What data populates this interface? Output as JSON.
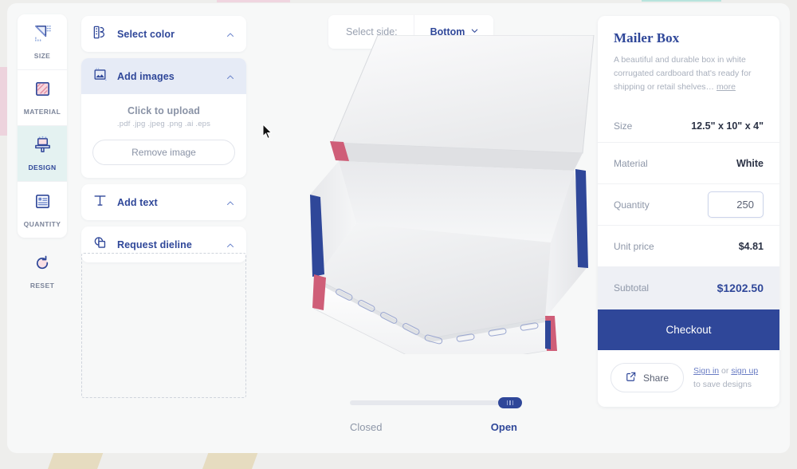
{
  "rail": {
    "items": [
      {
        "label": "SIZE",
        "icon": "ruler-triangle-icon",
        "active": false
      },
      {
        "label": "MATERIAL",
        "icon": "material-swatch-icon",
        "active": false
      },
      {
        "label": "DESIGN",
        "icon": "design-brush-icon",
        "active": true
      },
      {
        "label": "QUANTITY",
        "icon": "list-quantity-icon",
        "active": false
      }
    ],
    "reset": {
      "label": "RESET",
      "icon": "reset-circular-arrow-icon"
    }
  },
  "panel": {
    "select_color": {
      "label": "Select color",
      "icon": "color-palette-icon",
      "expanded": true
    },
    "add_images": {
      "label": "Add images",
      "icon": "image-frame-icon",
      "expanded": true,
      "upload_title": "Click to upload",
      "upload_formats": ".pdf .jpg .jpeg .png .ai .eps",
      "remove_label": "Remove image"
    },
    "add_text": {
      "label": "Add text",
      "icon": "text-t-icon",
      "expanded": true
    },
    "request_dieline": {
      "label": "Request dieline",
      "icon": "dieline-layers-icon",
      "expanded": true
    }
  },
  "stage": {
    "side_selector": {
      "label": "Select side:",
      "value": "Bottom",
      "icon": "chevron-down-icon"
    },
    "slider": {
      "left_label": "Closed",
      "right_label": "Open",
      "value": 100
    },
    "preview_alt": "white corrugated mailer box, open, bottom side"
  },
  "summary": {
    "title": "Mailer Box",
    "description": "A beautiful and durable box in white corrugated cardboard that's ready for shipping or retail shelves…",
    "more_link": "more",
    "rows": [
      {
        "key": "Size",
        "value": "12.5\" x 10\" x 4\""
      },
      {
        "key": "Material",
        "value": "White"
      }
    ],
    "quantity": {
      "key": "Quantity",
      "value": "250"
    },
    "unit_price": {
      "key": "Unit price",
      "value": "$4.81"
    },
    "subtotal": {
      "key": "Subtotal",
      "value": "$1202.50"
    },
    "checkout_label": "Checkout",
    "share_label": "Share",
    "share_icon": "share-external-icon",
    "save_note": {
      "sign_in": "Sign in",
      "or": " or ",
      "sign_up": "sign up",
      "tail": " to save designs"
    }
  },
  "colors": {
    "brand_blue": "#2f4799",
    "active_teal": "#e4f2f1",
    "accent_red": "#d4566e",
    "muted_text": "#8e97a8",
    "subtotal_bg": "#eef0f5"
  }
}
